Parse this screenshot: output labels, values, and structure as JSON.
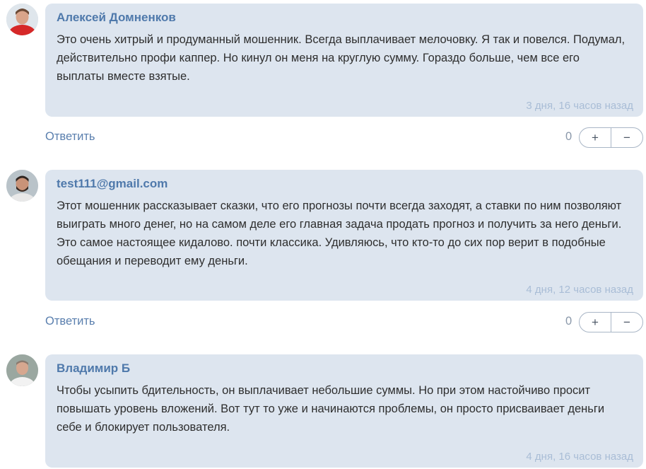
{
  "comments": [
    {
      "author": "Алексей Домненков",
      "avatar": "avatar-red-shirt-man",
      "text": "Это очень хитрый и продуманный мошенник. Всегда выплачивает мелочовку. Я так и повелся. Подумал, действительно профи каппер. Но кинул он меня на круглую сумму. Гораздо больше, чем все его выплаты вместе взятые.",
      "time": "3 дня, 16 часов назад",
      "reply_label": "Ответить",
      "votes": "0",
      "plus": "+",
      "minus": "−"
    },
    {
      "author": "test111@gmail.com",
      "avatar": "avatar-young-man-beard",
      "text": "Этот мошенник рассказывает сказки, что его прогнозы почти всегда заходят, а ставки по ним позволяют выиграть много денег, но на самом деле его главная задача продать прогноз и получить за него деньги. Это самое настоящее кидалово. почти классика. Удивляюсь, что кто-то до сих пор верит в подобные обещания и переводит ему деньги.",
      "time": "4 дня, 12 часов назад",
      "reply_label": "Ответить",
      "votes": "0",
      "plus": "+",
      "minus": "−"
    },
    {
      "author": "Владимир Б",
      "avatar": "avatar-man-white-shirt",
      "text": "Чтобы усыпить бдительность, он выплачивает небольшие суммы. Но при этом настойчиво просит повышать уровень вложений. Вот тут то уже и начинаются проблемы, он просто присваивает деньги себе и блокирует пользователя.",
      "time": "4 дня, 16 часов назад"
    }
  ],
  "colors": {
    "bubble": "#dde5ef",
    "author": "#4f79ab",
    "time": "#a9bdd6",
    "reply": "#5a7fae"
  }
}
